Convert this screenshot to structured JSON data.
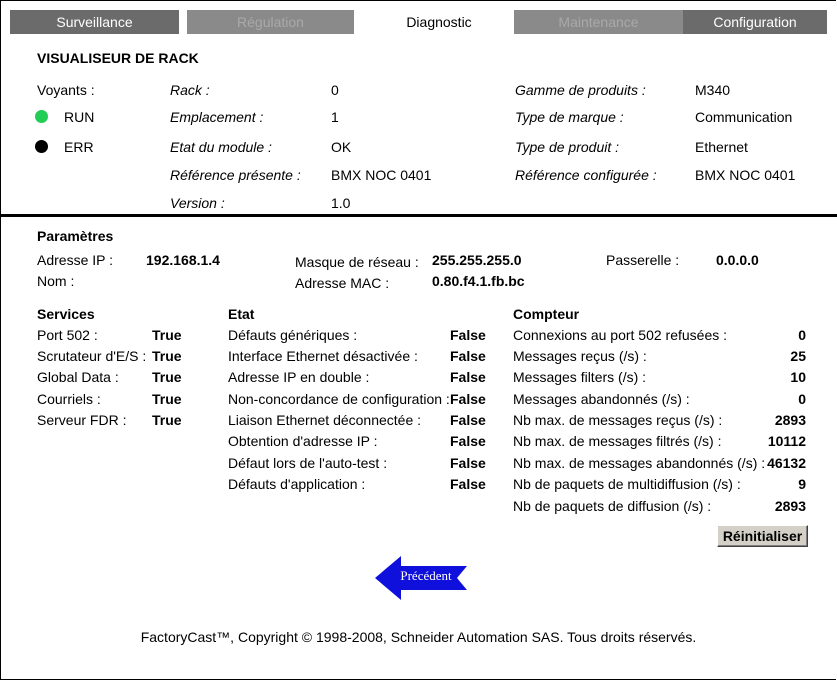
{
  "tabs": [
    {
      "label": "Surveillance",
      "state": "inactive"
    },
    {
      "label": "Régulation",
      "state": "disabled"
    },
    {
      "label": "Diagnostic",
      "state": "active"
    },
    {
      "label": "Maintenance",
      "state": "disabled"
    },
    {
      "label": "Configuration",
      "state": "inactive"
    }
  ],
  "rack": {
    "title": "VISUALISEUR DE RACK",
    "voyants_label": "Voyants :",
    "leds": [
      {
        "label": "RUN",
        "color": "#22cc55"
      },
      {
        "label": "ERR",
        "color": "#000000"
      }
    ],
    "left_fields": [
      {
        "label": "Rack :",
        "value": "0"
      },
      {
        "label": "Emplacement :",
        "value": "1"
      },
      {
        "label": "Etat du module :",
        "value": "OK"
      },
      {
        "label": "Référence présente :",
        "value": "BMX NOC 0401"
      },
      {
        "label": "Version :",
        "value": "1.0"
      }
    ],
    "right_fields": [
      {
        "label": "Gamme de produits :",
        "value": "M340"
      },
      {
        "label": "Type de marque :",
        "value": "Communication"
      },
      {
        "label": "Type de produit :",
        "value": "Ethernet"
      },
      {
        "label": "Référence configurée :",
        "value": "BMX NOC 0401"
      }
    ]
  },
  "params": {
    "title": "Paramètres",
    "ip_label": "Adresse IP :",
    "ip_value": "192.168.1.4",
    "nom_label": "Nom :",
    "mask_label": "Masque de réseau :",
    "mask_value": "255.255.255.0",
    "mac_label": "Adresse MAC :",
    "mac_value": "0.80.f4.1.fb.bc",
    "gw_label": "Passerelle :",
    "gw_value": "0.0.0.0"
  },
  "services": {
    "title": "Services",
    "items": [
      {
        "label": "Port 502 :",
        "value": "True"
      },
      {
        "label": "Scrutateur d'E/S :",
        "value": "True"
      },
      {
        "label": "Global Data :",
        "value": "True"
      },
      {
        "label": "Courriels :",
        "value": "True"
      },
      {
        "label": "Serveur FDR :",
        "value": "True"
      }
    ]
  },
  "etat": {
    "title": "Etat",
    "items": [
      {
        "label": "Défauts génériques :",
        "value": "False"
      },
      {
        "label": "Interface Ethernet désactivée :",
        "value": "False"
      },
      {
        "label": "Adresse IP en double :",
        "value": "False"
      },
      {
        "label": "Non-concordance de configuration :",
        "value": "False"
      },
      {
        "label": "Liaison Ethernet déconnectée :",
        "value": "False"
      },
      {
        "label": "Obtention d'adresse IP :",
        "value": "False"
      },
      {
        "label": "Défaut lors de l'auto-test :",
        "value": "False"
      },
      {
        "label": "Défauts d'application :",
        "value": "False"
      }
    ]
  },
  "compteur": {
    "title": "Compteur",
    "items": [
      {
        "label": "Connexions au port 502 refusées :",
        "value": "0"
      },
      {
        "label": "Messages reçus (/s) :",
        "value": "25"
      },
      {
        "label": "Messages filters (/s) :",
        "value": "10"
      },
      {
        "label": "Messages abandonnés (/s) :",
        "value": "0"
      },
      {
        "label": "Nb max. de messages reçus (/s) :",
        "value": "2893"
      },
      {
        "label": "Nb max. de messages filtrés (/s) :",
        "value": "10112"
      },
      {
        "label": "Nb max. de messages abandonnés (/s) :",
        "value": "46132"
      },
      {
        "label": "Nb de paquets de multidiffusion (/s) :",
        "value": "9"
      },
      {
        "label": "Nb de paquets de diffusion (/s) :",
        "value": "2893"
      }
    ],
    "reset_label": "Réinitialiser"
  },
  "back_button": {
    "label": "Précédent",
    "color": "#1010dd"
  },
  "footer": "FactoryCast™, Copyright © 1998-2008, Schneider Automation SAS. Tous droits réservés."
}
